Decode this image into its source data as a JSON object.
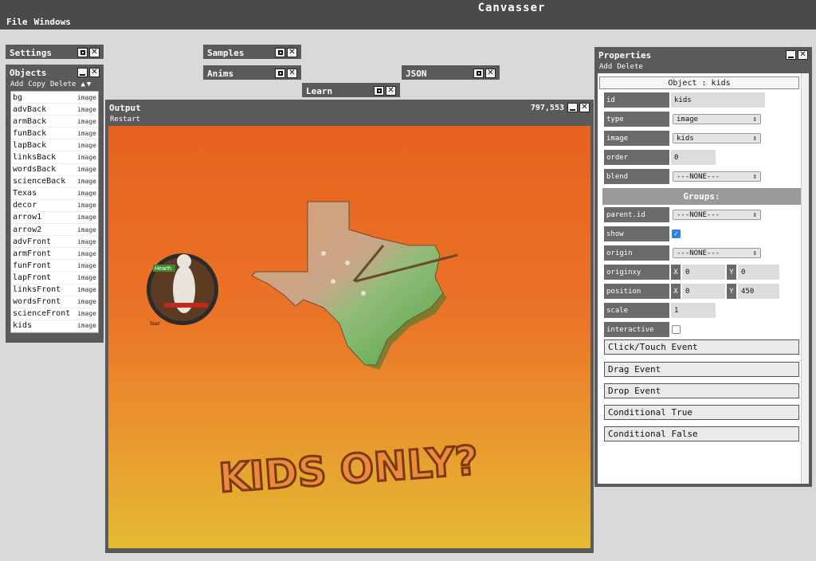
{
  "app": {
    "title": "Canvasser"
  },
  "menu": {
    "file": "File",
    "windows": "Windows"
  },
  "panels": {
    "settings": "Settings",
    "samples": "Samples",
    "anims": "Anims",
    "json": "JSON",
    "learn": "Learn",
    "objects": "Objects",
    "output": "Output",
    "properties": "Properties"
  },
  "objects": {
    "toolbar": {
      "add": "Add",
      "copy": "Copy",
      "delete": "Delete",
      "up": "▲",
      "down": "▼"
    },
    "items": [
      {
        "name": "bg",
        "kind": "image"
      },
      {
        "name": "advBack",
        "kind": "image"
      },
      {
        "name": "armBack",
        "kind": "image"
      },
      {
        "name": "funBack",
        "kind": "image"
      },
      {
        "name": "lapBack",
        "kind": "image"
      },
      {
        "name": "linksBack",
        "kind": "image"
      },
      {
        "name": "wordsBack",
        "kind": "image"
      },
      {
        "name": "scienceBack",
        "kind": "image"
      },
      {
        "name": "Texas",
        "kind": "image"
      },
      {
        "name": "decor",
        "kind": "image"
      },
      {
        "name": "arrow1",
        "kind": "image"
      },
      {
        "name": "arrow2",
        "kind": "image"
      },
      {
        "name": "advFront",
        "kind": "image"
      },
      {
        "name": "armFront",
        "kind": "image"
      },
      {
        "name": "funFront",
        "kind": "image"
      },
      {
        "name": "lapFront",
        "kind": "image"
      },
      {
        "name": "linksFront",
        "kind": "image"
      },
      {
        "name": "wordsFront",
        "kind": "image"
      },
      {
        "name": "scienceFront",
        "kind": "image"
      },
      {
        "name": "kids",
        "kind": "image"
      }
    ]
  },
  "output": {
    "coords": "797,553",
    "restart": "Restart",
    "banner": "KIDS ONLY?",
    "sign_label": "Hearth",
    "start_label": "Start"
  },
  "properties": {
    "toolbar": {
      "add": "Add",
      "delete": "Delete"
    },
    "header": "Object : kids",
    "id": {
      "label": "id",
      "value": "kids"
    },
    "type": {
      "label": "type",
      "value": "image"
    },
    "image": {
      "label": "image",
      "value": "kids"
    },
    "order": {
      "label": "order",
      "value": "0"
    },
    "blend": {
      "label": "blend",
      "value": "---NONE---"
    },
    "groups_header": "Groups:",
    "parent_id": {
      "label": "parent.id",
      "value": "---NONE---"
    },
    "show": {
      "label": "show",
      "checked": true
    },
    "origin": {
      "label": "origin",
      "value": "---NONE---"
    },
    "originxy": {
      "label": "originxy",
      "xlabel": "X",
      "x": "0",
      "ylabel": "Y",
      "y": "0"
    },
    "position": {
      "label": "position",
      "xlabel": "X",
      "x": "0",
      "ylabel": "Y",
      "y": "450"
    },
    "scale": {
      "label": "scale",
      "value": "1"
    },
    "interactive": {
      "label": "interactive",
      "checked": false
    },
    "events": {
      "click": "Click/Touch Event",
      "drag": "Drag Event",
      "drop": "Drop Event",
      "cond_true": "Conditional True",
      "cond_false": "Conditional False"
    }
  },
  "icons": {
    "maximize": "maximize-icon",
    "minimize": "minimize-icon",
    "close": "close-icon",
    "dropdown": "chevron-updown-icon",
    "check": "check-icon"
  },
  "colors": {
    "titlebar": "#5a5a5a",
    "topbar": "#4a4a4a",
    "stage_top": "#e7621f",
    "stage_bottom": "#e4bb33",
    "checkbox": "#2d7fe6"
  }
}
